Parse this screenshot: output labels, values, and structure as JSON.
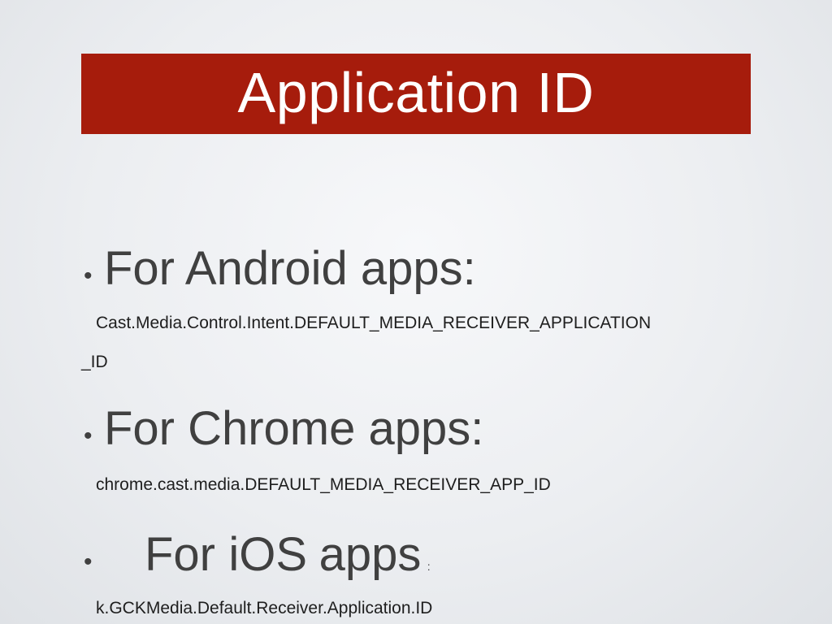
{
  "slide": {
    "title": "Application ID",
    "bullet_symbol": "•",
    "sections": [
      {
        "heading": "For Android apps:",
        "code_line_1": "Cast.Media.Control.Intent.DEFAULT_MEDIA_RECEIVER_APPLICATION",
        "code_line_2": "_ID"
      },
      {
        "heading": "For Chrome apps:",
        "code_line_1": "chrome.cast.media.DEFAULT_MEDIA_RECEIVER_APP_ID"
      },
      {
        "heading_part_1": "For",
        "heading_part_2": "iOS",
        "heading_part_3": "apps",
        "heading_colon": ":",
        "code_line_1": "k.GCKMedia.Default.Receiver.Application.ID"
      }
    ]
  },
  "colors": {
    "title_bar": "#a61c0c",
    "title_text": "#ffffff",
    "body_text": "#404040",
    "background": "#eceef1"
  }
}
